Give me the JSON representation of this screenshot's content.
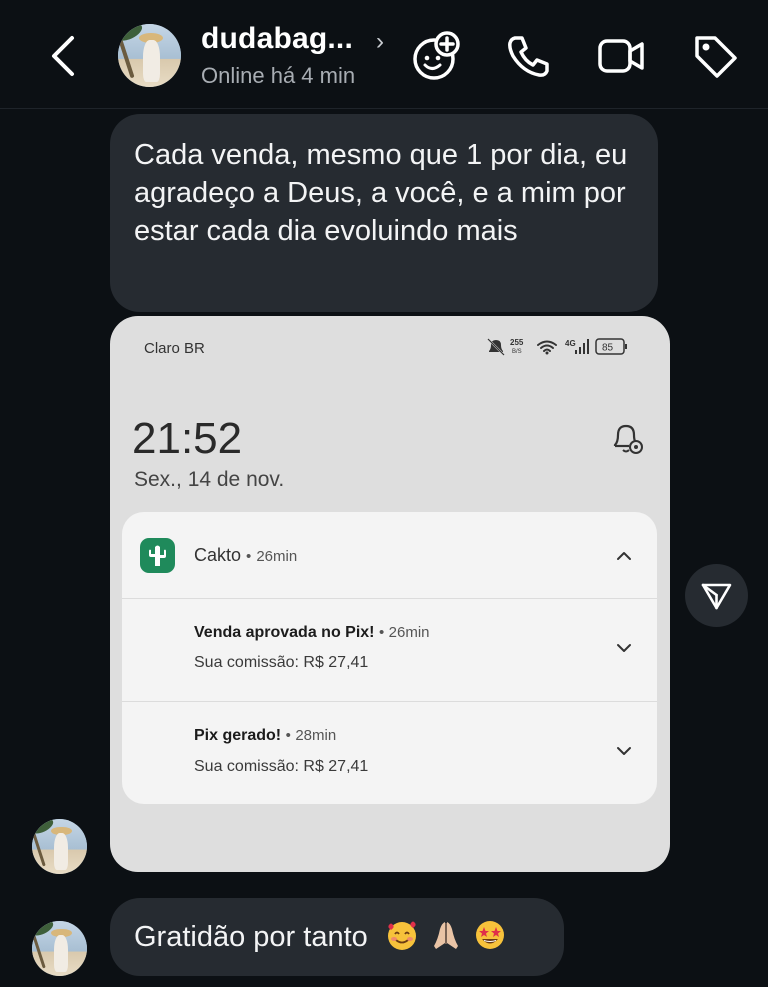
{
  "header": {
    "username": "dudabag...",
    "status": "Online há 4 min",
    "icons": [
      "back-chevron-icon",
      "chevron-right-icon",
      "sticker-add-icon",
      "phone-icon",
      "video-camera-icon",
      "tag-icon"
    ]
  },
  "messages": {
    "first": "Cada venda, mesmo que 1 por dia, eu agradeço a Deus, a você, e a mim por estar cada dia evoluindo mais",
    "last": "Gratidão por tanto",
    "last_emojis": [
      "smiling-face-with-hearts",
      "folded-hands",
      "star-struck"
    ]
  },
  "screenshot": {
    "carrier": "Claro BR",
    "net_speed": "255",
    "net_unit": "B/S",
    "network": "4G",
    "battery": "85",
    "time": "21:52",
    "date": "Sex., 14 de nov.",
    "app": {
      "name": "Cakto",
      "time": "26min"
    },
    "notifications": [
      {
        "title": "Venda aprovada no Pix!",
        "time": "26min",
        "body": "Sua comissão: R$ 27,41"
      },
      {
        "title": "Pix gerado!",
        "time": "28min",
        "body": "Sua comissão: R$ 27,41"
      }
    ]
  },
  "colors": {
    "background": "#0c1014",
    "bubble": "#262b31",
    "app_icon": "#1f8a5b"
  }
}
